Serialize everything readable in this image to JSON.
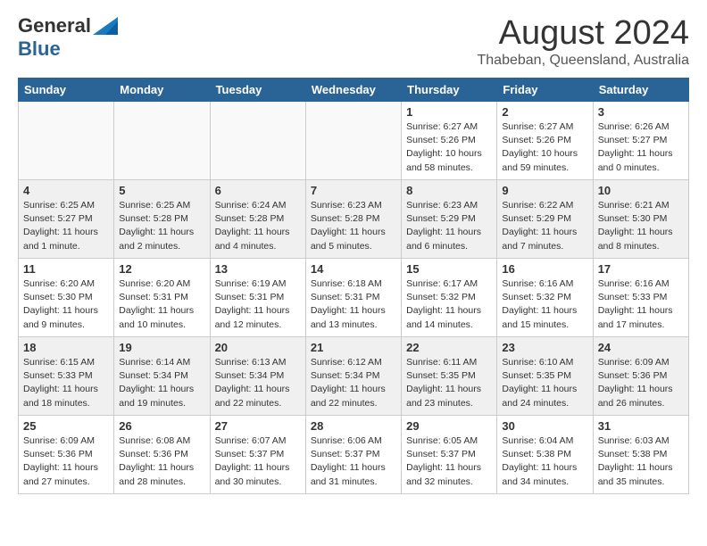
{
  "header": {
    "logo_general": "General",
    "logo_blue": "Blue",
    "month_title": "August 2024",
    "location": "Thabeban, Queensland, Australia"
  },
  "days_of_week": [
    "Sunday",
    "Monday",
    "Tuesday",
    "Wednesday",
    "Thursday",
    "Friday",
    "Saturday"
  ],
  "weeks": [
    [
      {
        "day": "",
        "info": ""
      },
      {
        "day": "",
        "info": ""
      },
      {
        "day": "",
        "info": ""
      },
      {
        "day": "",
        "info": ""
      },
      {
        "day": "1",
        "info": "Sunrise: 6:27 AM\nSunset: 5:26 PM\nDaylight: 10 hours and 58 minutes."
      },
      {
        "day": "2",
        "info": "Sunrise: 6:27 AM\nSunset: 5:26 PM\nDaylight: 10 hours and 59 minutes."
      },
      {
        "day": "3",
        "info": "Sunrise: 6:26 AM\nSunset: 5:27 PM\nDaylight: 11 hours and 0 minutes."
      }
    ],
    [
      {
        "day": "4",
        "info": "Sunrise: 6:25 AM\nSunset: 5:27 PM\nDaylight: 11 hours and 1 minute."
      },
      {
        "day": "5",
        "info": "Sunrise: 6:25 AM\nSunset: 5:28 PM\nDaylight: 11 hours and 2 minutes."
      },
      {
        "day": "6",
        "info": "Sunrise: 6:24 AM\nSunset: 5:28 PM\nDaylight: 11 hours and 4 minutes."
      },
      {
        "day": "7",
        "info": "Sunrise: 6:23 AM\nSunset: 5:28 PM\nDaylight: 11 hours and 5 minutes."
      },
      {
        "day": "8",
        "info": "Sunrise: 6:23 AM\nSunset: 5:29 PM\nDaylight: 11 hours and 6 minutes."
      },
      {
        "day": "9",
        "info": "Sunrise: 6:22 AM\nSunset: 5:29 PM\nDaylight: 11 hours and 7 minutes."
      },
      {
        "day": "10",
        "info": "Sunrise: 6:21 AM\nSunset: 5:30 PM\nDaylight: 11 hours and 8 minutes."
      }
    ],
    [
      {
        "day": "11",
        "info": "Sunrise: 6:20 AM\nSunset: 5:30 PM\nDaylight: 11 hours and 9 minutes."
      },
      {
        "day": "12",
        "info": "Sunrise: 6:20 AM\nSunset: 5:31 PM\nDaylight: 11 hours and 10 minutes."
      },
      {
        "day": "13",
        "info": "Sunrise: 6:19 AM\nSunset: 5:31 PM\nDaylight: 11 hours and 12 minutes."
      },
      {
        "day": "14",
        "info": "Sunrise: 6:18 AM\nSunset: 5:31 PM\nDaylight: 11 hours and 13 minutes."
      },
      {
        "day": "15",
        "info": "Sunrise: 6:17 AM\nSunset: 5:32 PM\nDaylight: 11 hours and 14 minutes."
      },
      {
        "day": "16",
        "info": "Sunrise: 6:16 AM\nSunset: 5:32 PM\nDaylight: 11 hours and 15 minutes."
      },
      {
        "day": "17",
        "info": "Sunrise: 6:16 AM\nSunset: 5:33 PM\nDaylight: 11 hours and 17 minutes."
      }
    ],
    [
      {
        "day": "18",
        "info": "Sunrise: 6:15 AM\nSunset: 5:33 PM\nDaylight: 11 hours and 18 minutes."
      },
      {
        "day": "19",
        "info": "Sunrise: 6:14 AM\nSunset: 5:34 PM\nDaylight: 11 hours and 19 minutes."
      },
      {
        "day": "20",
        "info": "Sunrise: 6:13 AM\nSunset: 5:34 PM\nDaylight: 11 hours and 22 minutes."
      },
      {
        "day": "21",
        "info": "Sunrise: 6:12 AM\nSunset: 5:34 PM\nDaylight: 11 hours and 22 minutes."
      },
      {
        "day": "22",
        "info": "Sunrise: 6:11 AM\nSunset: 5:35 PM\nDaylight: 11 hours and 23 minutes."
      },
      {
        "day": "23",
        "info": "Sunrise: 6:10 AM\nSunset: 5:35 PM\nDaylight: 11 hours and 24 minutes."
      },
      {
        "day": "24",
        "info": "Sunrise: 6:09 AM\nSunset: 5:36 PM\nDaylight: 11 hours and 26 minutes."
      }
    ],
    [
      {
        "day": "25",
        "info": "Sunrise: 6:09 AM\nSunset: 5:36 PM\nDaylight: 11 hours and 27 minutes."
      },
      {
        "day": "26",
        "info": "Sunrise: 6:08 AM\nSunset: 5:36 PM\nDaylight: 11 hours and 28 minutes."
      },
      {
        "day": "27",
        "info": "Sunrise: 6:07 AM\nSunset: 5:37 PM\nDaylight: 11 hours and 30 minutes."
      },
      {
        "day": "28",
        "info": "Sunrise: 6:06 AM\nSunset: 5:37 PM\nDaylight: 11 hours and 31 minutes."
      },
      {
        "day": "29",
        "info": "Sunrise: 6:05 AM\nSunset: 5:37 PM\nDaylight: 11 hours and 32 minutes."
      },
      {
        "day": "30",
        "info": "Sunrise: 6:04 AM\nSunset: 5:38 PM\nDaylight: 11 hours and 34 minutes."
      },
      {
        "day": "31",
        "info": "Sunrise: 6:03 AM\nSunset: 5:38 PM\nDaylight: 11 hours and 35 minutes."
      }
    ]
  ],
  "alt_rows": [
    1,
    3
  ]
}
